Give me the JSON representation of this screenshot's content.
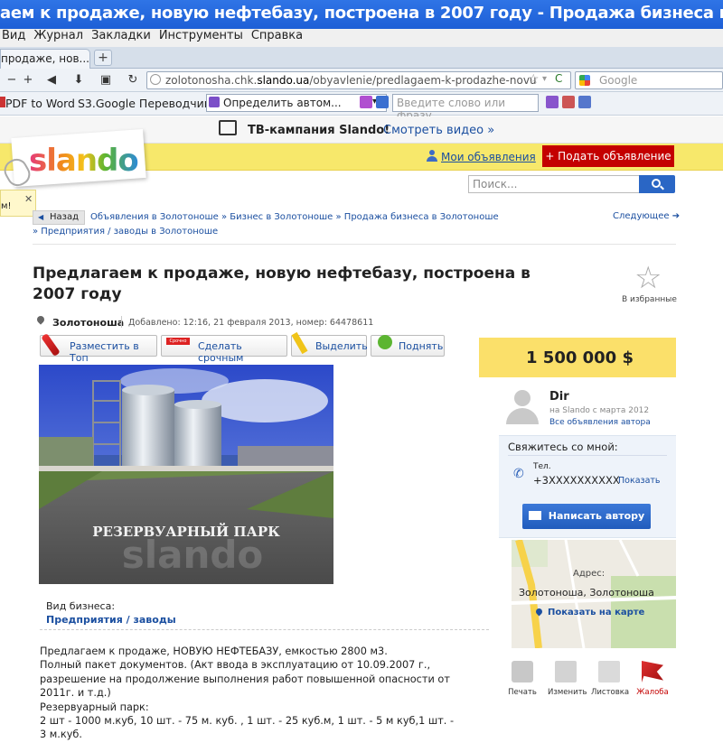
{
  "browser": {
    "title": "аем к продаже, новую нефтебазу, построена в 2007 году - Продажа бизнеса в Золо...",
    "menu": [
      "Вид",
      "Журнал",
      "Закладки",
      "Инструменты",
      "Справка"
    ],
    "tab_label": "продаже, нов...",
    "url_prefix": "zolotonosha.chk.",
    "url_domain": "slando.ua",
    "url_path": "/obyavlenie/predlagaem-k-prodazhe-novu",
    "search_placeholder": "Google",
    "bookmarks": {
      "pdf": "PDF to Word",
      "translator": "S3.Google Переводчик",
      "detect": "Определить автом...",
      "dict_placeholder": "Введите слово или фразу"
    }
  },
  "promo": {
    "text": "ТВ-кампания Slando!",
    "link": "Смотреть видео »"
  },
  "header": {
    "logo": "slando",
    "my_ads": "Мои объявления",
    "post_ad": "+ Подать объявление",
    "search_placeholder": "Поиск...",
    "notice": "м!"
  },
  "breadcrumb": {
    "back": "Назад",
    "path": "Объявления в Золотоноше » Бизнес в Золотоноше » Продажа бизнеса в Золотоноше",
    "path2": "» Предприятия / заводы в Золотоноше",
    "next": "Следующее"
  },
  "listing": {
    "title": "Предлагаем к продаже, новую нефтебазу, построена в 2007 году",
    "favorite": "В избранные",
    "city": "Золотоноша",
    "added": "Добавлено: 12:16, 21 февраля 2013, номер: 64478611",
    "actions": {
      "top": "Разместить в Топ",
      "urgent": "Сделать срочным",
      "highlight": "Выделить",
      "raise": "Поднять",
      "urgent_tag": "Срочно"
    },
    "photo_caption": "РЕЗЕРВУАРНЫЙ   ПАРК",
    "photo_watermark": "slando",
    "business_type_label": "Вид бизнеса:",
    "business_type": "Предприятия / заводы",
    "description": [
      "Предлагаем к продаже, НОВУЮ НЕФТЕБАЗУ, емкостью 2800 м3.",
      "Полный пакет документов. (Акт ввода в эксплуатацию от 10.09.2007 г.,",
      "разрешение на продолжение выполнения работ повышенной опасности от",
      "2011г. и т.д.)",
      "Резервуарный парк:",
      "2 шт - 1000 м.куб, 10 шт. - 75 м. куб. , 1 шт. - 25 куб.м, 1 шт. - 5 м куб,1 шт. -",
      "3 м.куб."
    ]
  },
  "sidebar": {
    "price": "1 500 000 $",
    "author": "Dir",
    "since": "на Slando с марта 2012",
    "all_ads": "Все объявления автора",
    "contact_heading": "Свяжитесь со мной:",
    "phone_label": "Тел.",
    "phone": "+3XXXXXXXXXX",
    "show": "Показать",
    "write": "Написать автору",
    "address_label": "Адрес:",
    "address": "Золотоноша, Золотоноша",
    "show_map": "Показать на карте",
    "tools": [
      "Печать",
      "Изменить",
      "Листовка",
      "Жалоба"
    ]
  },
  "colors": {
    "brand_yellow": "#f7e86b",
    "link": "#1b4fa0",
    "post_ad_red": "#c40000",
    "complaint": "#c40000"
  }
}
